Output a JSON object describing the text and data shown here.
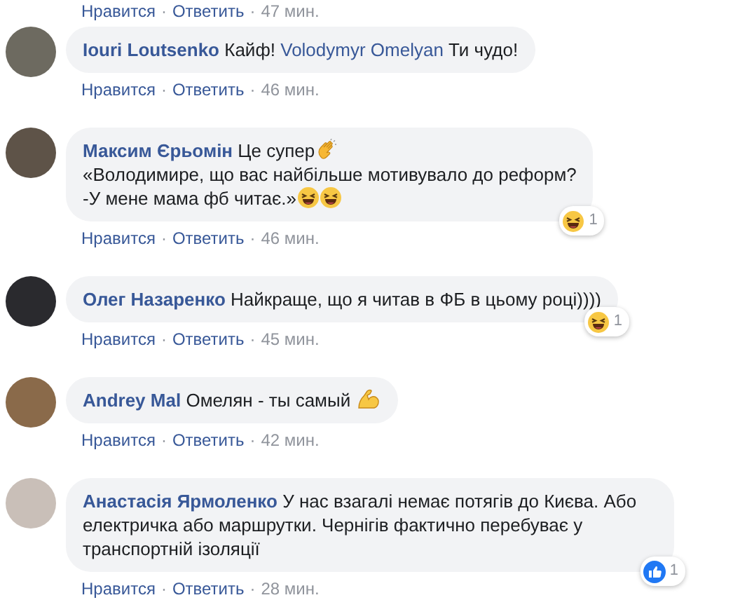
{
  "separator": "·",
  "top_actions": {
    "like": "Нравится",
    "reply": "Ответить",
    "time": "47 мин."
  },
  "comments": [
    {
      "author": "Iouri Loutsenko",
      "body": [
        {
          "kind": "text",
          "text": "Кайф! "
        },
        {
          "kind": "mention",
          "text": "Volodymyr Omelyan"
        },
        {
          "kind": "text",
          "text": " Ти чудо!"
        }
      ],
      "like": "Нравится",
      "reply": "Ответить",
      "time": "46 мин."
    },
    {
      "author": "Максим Єрьомін",
      "body": [
        {
          "kind": "text",
          "text": "Це супер"
        },
        {
          "kind": "clap"
        },
        {
          "kind": "break"
        },
        {
          "kind": "text",
          "text": "«Володимире, що вас найбільше мотивувало до реформ?"
        },
        {
          "kind": "break"
        },
        {
          "kind": "text",
          "text": "-У мене мама фб читає.»"
        },
        {
          "kind": "laugh"
        },
        {
          "kind": "laugh"
        }
      ],
      "reaction": {
        "kind": "haha",
        "count": "1"
      },
      "like": "Нравится",
      "reply": "Ответить",
      "time": "46 мин."
    },
    {
      "author": "Олег Назаренко",
      "body": [
        {
          "kind": "text",
          "text": "Найкраще, що я читав в ФБ в цьому році))))"
        }
      ],
      "reaction": {
        "kind": "haha",
        "count": "1"
      },
      "like": "Нравится",
      "reply": "Ответить",
      "time": "45 мин."
    },
    {
      "author": "Andrey Mal",
      "body": [
        {
          "kind": "text",
          "text": "Омелян - ты самый "
        },
        {
          "kind": "muscle"
        }
      ],
      "like": "Нравится",
      "reply": "Ответить",
      "time": "42 мин."
    },
    {
      "author": "Анастасія Ярмоленко",
      "body": [
        {
          "kind": "text",
          "text": "У нас взагалі немає потягів до Києва. Або електричка або маршрутки. Чернігів фактично перебуває у транспортній ізоляції"
        }
      ],
      "reaction": {
        "kind": "like",
        "count": "1"
      },
      "like": "Нравится",
      "reply": "Ответить",
      "time": "28 мин."
    }
  ]
}
